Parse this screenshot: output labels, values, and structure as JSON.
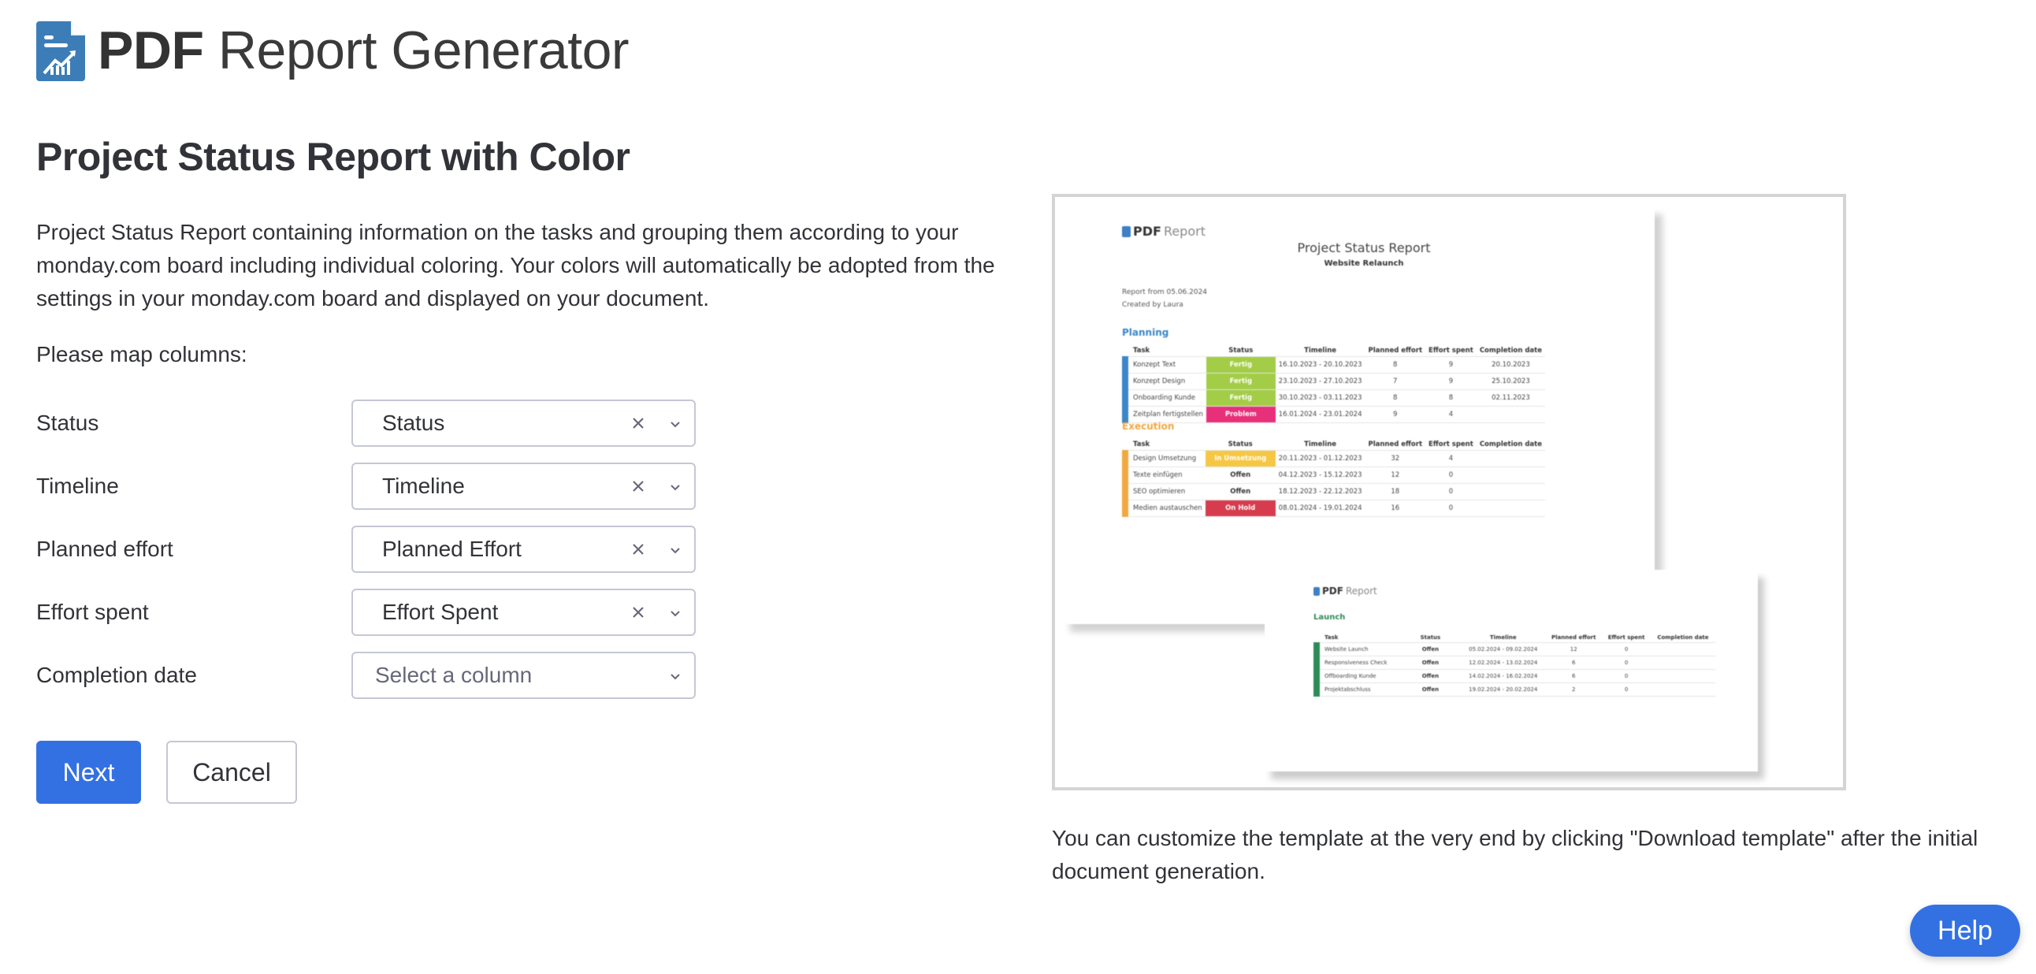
{
  "app": {
    "brand_bold": "PDF",
    "brand_regular": " Report Generator",
    "logo_icon": "document-chart-icon",
    "logo_color": "#3c7db8"
  },
  "page": {
    "title": "Project Status Report with Color",
    "description": "Project Status Report containing information on the tasks and grouping them according to your monday.com board including individual coloring. Your colors will automatically be adopted from the settings in your monday.com board and displayed on your document.",
    "map_columns_label": "Please map columns:"
  },
  "mapping": [
    {
      "label": "Status",
      "value": "Status",
      "placeholder": "Select a column",
      "clearable": true
    },
    {
      "label": "Timeline",
      "value": "Timeline",
      "placeholder": "Select a column",
      "clearable": true
    },
    {
      "label": "Planned effort",
      "value": "Planned Effort",
      "placeholder": "Select a column",
      "clearable": true
    },
    {
      "label": "Effort spent",
      "value": "Effort Spent",
      "placeholder": "Select a column",
      "clearable": true
    },
    {
      "label": "Completion date",
      "value": "",
      "placeholder": "Select a column",
      "clearable": false
    }
  ],
  "buttons": {
    "next": "Next",
    "cancel": "Cancel",
    "help": "Help"
  },
  "colors": {
    "primary": "#3371e3",
    "border": "#c5c7d4"
  },
  "preview": {
    "logo_bold": "PDF",
    "logo_regular": "Report",
    "title": "Project Status Report",
    "subtitle": "Website Relaunch",
    "report_from": "Report from 05.06.2024",
    "created_by": "Created by Laura",
    "columns": [
      "Task",
      "Status",
      "Timeline",
      "Planned effort",
      "Effort spent",
      "Completion date"
    ],
    "groups": [
      {
        "name": "Planning",
        "color": "#3a86c8",
        "rows": [
          {
            "task": "Konzept Text",
            "status": "Fertig",
            "status_color": "#a3cd46",
            "timeline": "16.10.2023 - 20.10.2023",
            "planned": "8",
            "spent": "9",
            "completion": "20.10.2023"
          },
          {
            "task": "Konzept Design",
            "status": "Fertig",
            "status_color": "#a3cd46",
            "timeline": "23.10.2023 - 27.10.2023",
            "planned": "7",
            "spent": "9",
            "completion": "25.10.2023"
          },
          {
            "task": "Onboarding Kunde",
            "status": "Fertig",
            "status_color": "#a3cd46",
            "timeline": "30.10.2023 - 03.11.2023",
            "planned": "8",
            "spent": "8",
            "completion": "02.11.2023"
          },
          {
            "task": "Zeitplan fertigstellen",
            "status": "Problem",
            "status_color": "#e8307a",
            "timeline": "16.01.2024 - 23.01.2024",
            "planned": "9",
            "spent": "4",
            "completion": ""
          }
        ]
      },
      {
        "name": "Execution",
        "color": "#f0a940",
        "rows": [
          {
            "task": "Design Umsetzung",
            "status": "In Umsetzung",
            "status_color": "#f6c744",
            "timeline": "20.11.2023 - 01.12.2023",
            "planned": "32",
            "spent": "4",
            "completion": ""
          },
          {
            "task": "Texte einfügen",
            "status": "Offen",
            "status_color": "",
            "timeline": "04.12.2023 - 15.12.2023",
            "planned": "12",
            "spent": "0",
            "completion": ""
          },
          {
            "task": "SEO optimieren",
            "status": "Offen",
            "status_color": "",
            "timeline": "18.12.2023 - 22.12.2023",
            "planned": "18",
            "spent": "0",
            "completion": ""
          },
          {
            "task": "Medien austauschen",
            "status": "On Hold",
            "status_color": "#d63c4e",
            "timeline": "08.01.2024 - 19.01.2024",
            "planned": "16",
            "spent": "0",
            "completion": ""
          }
        ]
      },
      {
        "name": "Launch",
        "color": "#2e8b57",
        "rows": [
          {
            "task": "Website Launch",
            "status": "Offen",
            "status_color": "",
            "timeline": "05.02.2024 - 09.02.2024",
            "planned": "12",
            "spent": "0",
            "completion": ""
          },
          {
            "task": "Responsiveness Check",
            "status": "Offen",
            "status_color": "",
            "timeline": "12.02.2024 - 13.02.2024",
            "planned": "6",
            "spent": "0",
            "completion": ""
          },
          {
            "task": "Offboarding Kunde",
            "status": "Offen",
            "status_color": "",
            "timeline": "14.02.2024 - 16.02.2024",
            "planned": "6",
            "spent": "0",
            "completion": ""
          },
          {
            "task": "Projektabschluss",
            "status": "Offen",
            "status_color": "",
            "timeline": "19.02.2024 - 20.02.2024",
            "planned": "2",
            "spent": "0",
            "completion": ""
          }
        ]
      }
    ]
  },
  "hint": "You can customize the template at the very end by clicking \"Download template\" after the initial document generation."
}
